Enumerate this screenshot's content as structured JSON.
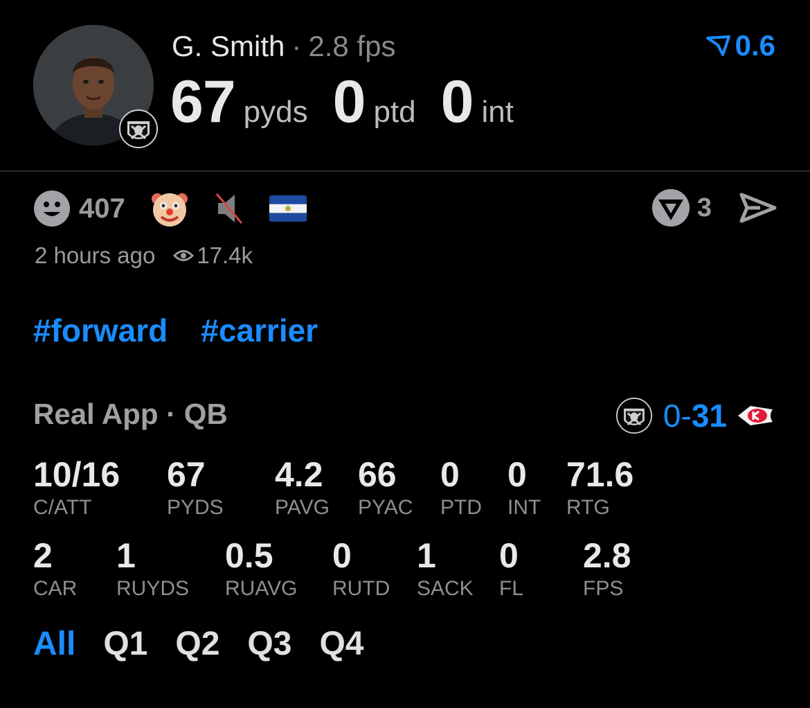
{
  "player": {
    "name": "G. Smith",
    "fps_text": "2.8 fps",
    "team_badge_text": "RAIDERS"
  },
  "headline_stats": [
    {
      "value": "67",
      "unit": "pyds"
    },
    {
      "value": "0",
      "unit": "ptd"
    },
    {
      "value": "0",
      "unit": "int"
    }
  ],
  "boost": {
    "value": "0.6",
    "icon": "boost-arrow-icon",
    "color": "#1a8cff"
  },
  "reactions": {
    "smile_count": "407",
    "emoji": [
      "clown-face",
      "muted-speaker",
      "el-salvador-flag"
    ],
    "vote_count": "3"
  },
  "meta": {
    "time_ago": "2 hours ago",
    "views": "17.4k"
  },
  "tags": [
    "#forward",
    "#carrier"
  ],
  "section": {
    "title": "Real App · QB"
  },
  "score": {
    "away": "0",
    "sep": "-",
    "home": "31",
    "away_team": "RAIDERS",
    "home_team": "KC"
  },
  "passing_stats": [
    {
      "value": "10/16",
      "label": "C/ATT"
    },
    {
      "value": "67",
      "label": "PYDS"
    },
    {
      "value": "4.2",
      "label": "PAVG"
    },
    {
      "value": "66",
      "label": "PYAC"
    },
    {
      "value": "0",
      "label": "PTD"
    },
    {
      "value": "0",
      "label": "INT"
    },
    {
      "value": "71.6",
      "label": "RTG"
    }
  ],
  "rushing_stats": [
    {
      "value": "2",
      "label": "CAR"
    },
    {
      "value": "1",
      "label": "RUYDS"
    },
    {
      "value": "0.5",
      "label": "RUAVG"
    },
    {
      "value": "0",
      "label": "RUTD"
    },
    {
      "value": "1",
      "label": "SACK"
    },
    {
      "value": "0",
      "label": "FL"
    },
    {
      "value": "2.8",
      "label": "FPS"
    }
  ],
  "tabs": [
    {
      "label": "All",
      "active": true
    },
    {
      "label": "Q1",
      "active": false
    },
    {
      "label": "Q2",
      "active": false
    },
    {
      "label": "Q3",
      "active": false
    },
    {
      "label": "Q4",
      "active": false
    }
  ],
  "colors": {
    "accent": "#1a8cff",
    "background": "#000000",
    "muted": "#8e8e93"
  }
}
